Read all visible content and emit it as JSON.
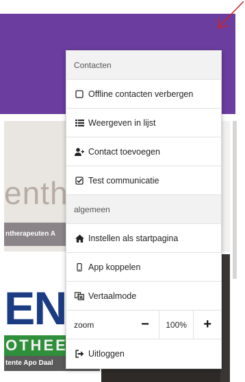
{
  "header": {
    "icons": [
      "search-icon",
      "bell-icon",
      "kebab-menu-icon"
    ],
    "background_color": "#6a3d9e"
  },
  "tiles": [
    {
      "word": "enthera",
      "caption": "ntherapeuten A"
    },
    {
      "letters": "EN",
      "band": "OTHEE",
      "caption": "tente Apo Daal"
    }
  ],
  "menu": {
    "section_contacts": "Contacten",
    "items_contacts": [
      {
        "label": "Offline contacten verbergen",
        "icon": "checkbox-empty-icon"
      },
      {
        "label": "Weergeven in lijst",
        "icon": "list-icon"
      },
      {
        "label": "Contact toevoegen",
        "icon": "user-plus-icon"
      },
      {
        "label": "Test communicatie",
        "icon": "checkbox-checked-icon"
      }
    ],
    "section_general": "algemeen",
    "items_general": [
      {
        "label": "Instellen als startpagina",
        "icon": "home-icon"
      },
      {
        "label": "App koppelen",
        "icon": "mobile-icon"
      },
      {
        "label": "Vertaalmode",
        "icon": "translate-icon"
      }
    ],
    "zoom": {
      "label": "zoom",
      "value": "100%",
      "minus": "−",
      "plus": "+"
    },
    "logout": {
      "label": "Uitloggen",
      "icon": "sign-out-icon"
    }
  },
  "colors": {
    "accent": "#6a3d9e",
    "annotation": "#d0232a"
  }
}
